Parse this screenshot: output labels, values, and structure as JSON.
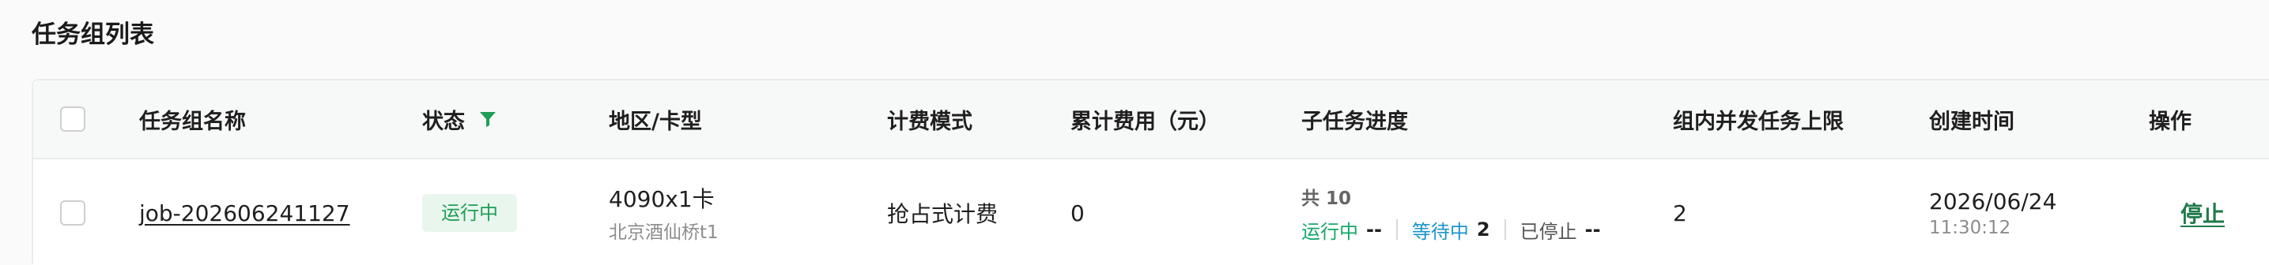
{
  "page": {
    "title": "任务组列表"
  },
  "table": {
    "headers": {
      "name": "任务组名称",
      "status": "状态",
      "region": "地区/卡型",
      "billing": "计费模式",
      "cost": "累计费用（元）",
      "progress": "子任务进度",
      "concurrency": "组内并发任务上限",
      "created": "创建时间",
      "actions": "操作"
    },
    "rows": [
      {
        "name": "job-202606241127",
        "status": "运行中",
        "card": "4090x1卡",
        "region": "北京酒仙桥t1",
        "billing": "抢占式计费",
        "cost": "0",
        "progress": {
          "total": "共 10",
          "running_label": "运行中",
          "running_value": "--",
          "waiting_label": "等待中",
          "waiting_value": "2",
          "stopped_label": "已停止",
          "stopped_value": "--"
        },
        "concurrency": "2",
        "created_date": "2026/06/24",
        "created_time": "11:30:12",
        "action": "停止"
      }
    ]
  },
  "colors": {
    "status_running": "#1f9e57",
    "progress_running": "#17a86a",
    "progress_waiting": "#1d95c9",
    "filter_icon": "#1f9e57",
    "action_link": "#1f7a4a"
  },
  "icons": {
    "status_filter": "filter-icon"
  }
}
